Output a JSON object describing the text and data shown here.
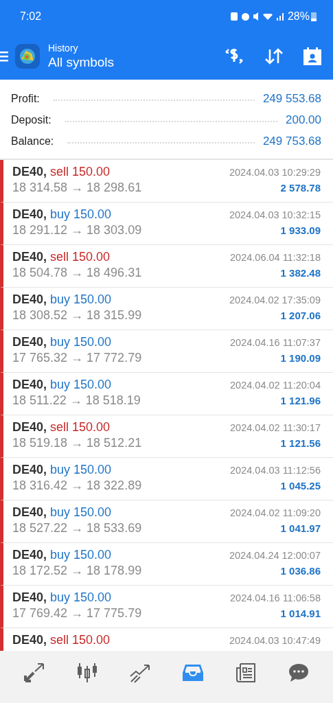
{
  "status_bar": {
    "time": "7:02",
    "battery": "28%"
  },
  "header": {
    "subtitle": "History",
    "title": "All symbols"
  },
  "summary": [
    {
      "label": "Profit:",
      "value": "249 553.68"
    },
    {
      "label": "Deposit:",
      "value": "200.00"
    },
    {
      "label": "Balance:",
      "value": "249 753.68"
    }
  ],
  "deals": [
    {
      "symbol": "DE40,",
      "kind": "sell",
      "action": "sell 150.00",
      "prices": "18 314.58 → 18 298.61",
      "time": "2024.04.03 10:29:29",
      "profit": "2 578.78"
    },
    {
      "symbol": "DE40,",
      "kind": "buy",
      "action": "buy 150.00",
      "prices": "18 291.12 → 18 303.09",
      "time": "2024.04.03 10:32:15",
      "profit": "1 933.09"
    },
    {
      "symbol": "DE40,",
      "kind": "sell",
      "action": "sell 150.00",
      "prices": "18 504.78 → 18 496.31",
      "time": "2024.06.04 11:32:18",
      "profit": "1 382.48"
    },
    {
      "symbol": "DE40,",
      "kind": "buy",
      "action": "buy 150.00",
      "prices": "18 308.52 → 18 315.99",
      "time": "2024.04.02 17:35:09",
      "profit": "1 207.06"
    },
    {
      "symbol": "DE40,",
      "kind": "buy",
      "action": "buy 150.00",
      "prices": "17 765.32 → 17 772.79",
      "time": "2024.04.16 11:07:37",
      "profit": "1 190.09"
    },
    {
      "symbol": "DE40,",
      "kind": "buy",
      "action": "buy 150.00",
      "prices": "18 511.22 → 18 518.19",
      "time": "2024.04.02 11:20:04",
      "profit": "1 121.96"
    },
    {
      "symbol": "DE40,",
      "kind": "sell",
      "action": "sell 150.00",
      "prices": "18 519.18 → 18 512.21",
      "time": "2024.04.02 11:30:17",
      "profit": "1 121.56"
    },
    {
      "symbol": "DE40,",
      "kind": "buy",
      "action": "buy 150.00",
      "prices": "18 316.42 → 18 322.89",
      "time": "2024.04.03 11:12:56",
      "profit": "1 045.25"
    },
    {
      "symbol": "DE40,",
      "kind": "buy",
      "action": "buy 150.00",
      "prices": "18 527.22 → 18 533.69",
      "time": "2024.04.02 11:09:20",
      "profit": "1 041.97"
    },
    {
      "symbol": "DE40,",
      "kind": "buy",
      "action": "buy 150.00",
      "prices": "18 172.52 → 18 178.99",
      "time": "2024.04.24 12:00:07",
      "profit": "1 036.86"
    },
    {
      "symbol": "DE40,",
      "kind": "buy",
      "action": "buy 150.00",
      "prices": "17 769.42 → 17 775.79",
      "time": "2024.04.16 11:06:58",
      "profit": "1 014.91"
    }
  ],
  "partial_deal": {
    "symbol": "DE40,",
    "kind": "sell",
    "action": "sell 150.00",
    "time": "2024.04.03 10:47:49"
  },
  "nav": [
    {
      "kind": "trade",
      "selected": false
    },
    {
      "kind": "quotes",
      "selected": false
    },
    {
      "kind": "chart",
      "selected": false
    },
    {
      "kind": "history",
      "selected": true
    },
    {
      "kind": "news",
      "selected": false
    },
    {
      "kind": "chat",
      "selected": false
    }
  ]
}
